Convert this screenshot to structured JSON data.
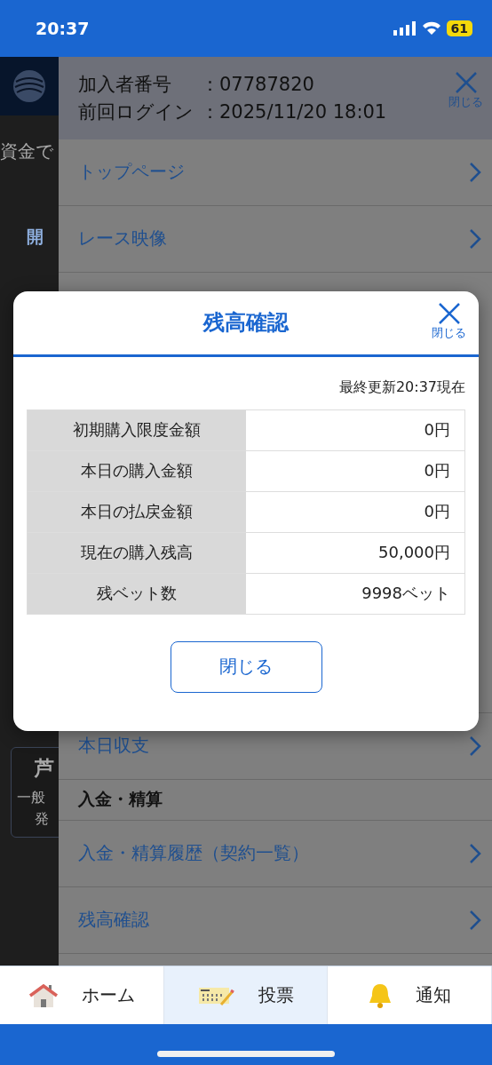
{
  "status_bar": {
    "time": "20:37",
    "battery": "61"
  },
  "background": {
    "texts": [
      "資金で",
      "開",
      "芦",
      "一般",
      "発"
    ]
  },
  "drawer": {
    "member_label": "加入者番号",
    "member_value": "：07787820",
    "login_label": "前回ログイン",
    "login_value": "：2025/11/20 18:01",
    "close_label": "閉じる",
    "items_top": [
      {
        "kind": "link",
        "label": "トップページ"
      },
      {
        "kind": "link",
        "label": "レース映像"
      }
    ],
    "items_bottom": [
      {
        "kind": "link",
        "label": "本日収支"
      },
      {
        "kind": "section",
        "label": "入金・精算"
      },
      {
        "kind": "link",
        "label": "入金・精算履歴（契約一覧）"
      },
      {
        "kind": "link",
        "label": "残高確認"
      }
    ]
  },
  "modal": {
    "title": "残高確認",
    "close_label": "閉じる",
    "updated": "最終更新20:37現在",
    "rows": [
      {
        "label": "初期購入限度金額",
        "value": "0円"
      },
      {
        "label": "本日の購入金額",
        "value": "0円"
      },
      {
        "label": "本日の払戻金額",
        "value": "0円"
      },
      {
        "label": "現在の購入残高",
        "value": "50,000円"
      },
      {
        "label": "残ベット数",
        "value": "9998ベット"
      }
    ],
    "button": "閉じる"
  },
  "bottom_nav": [
    {
      "kind": "home",
      "label": "ホーム",
      "selected": false
    },
    {
      "kind": "vote",
      "label": "投票",
      "selected": true
    },
    {
      "kind": "bell",
      "label": "通知",
      "selected": false
    }
  ]
}
